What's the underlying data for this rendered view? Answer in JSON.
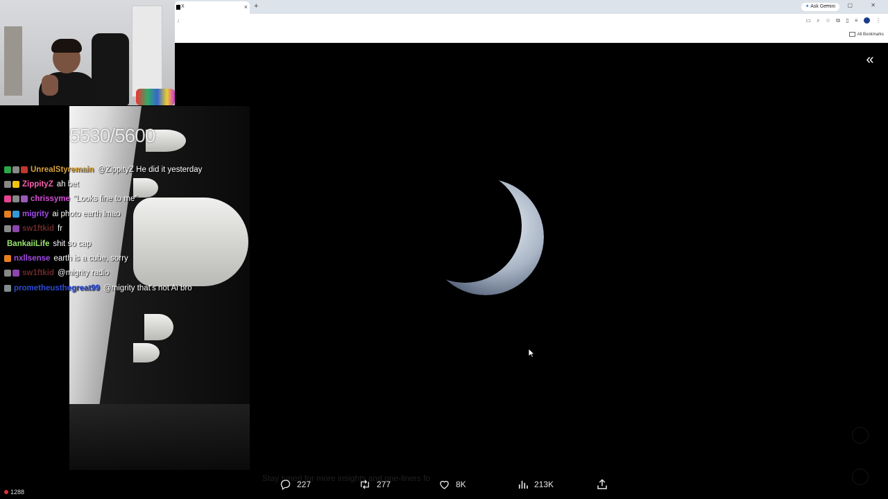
{
  "browser": {
    "tab_title": "X",
    "tab_close": "×",
    "new_tab": "+",
    "ask_gemini_label": "Ask Gemini",
    "address": "/",
    "all_bookmarks": "All Bookmarks",
    "window_controls": "– ▢ ✕"
  },
  "stream": {
    "counter": "5530/5600",
    "viewer_count": "1288",
    "chat": [
      {
        "user": "UnrealStyremain",
        "color": "#d7a33a",
        "text": "@ZippityZ He did it yesterday",
        "badges": [
          "#2aa84a",
          "#888888",
          "#c0392b"
        ]
      },
      {
        "user": "ZippityZ",
        "color": "#ff5fb0",
        "text": "ah bet",
        "badges": [
          "#888888",
          "#f1c40f"
        ]
      },
      {
        "user": "chrissyme",
        "color": "#d64fd6",
        "text": "\"Looks fine to me\"",
        "badges": [
          "#e84393",
          "#888888",
          "#9b59b6"
        ]
      },
      {
        "user": "migrity",
        "color": "#a24be6",
        "text": "ai photo earth lmao",
        "badges": [
          "#e67e22",
          "#3498db"
        ]
      },
      {
        "user": "sw1ftkid",
        "color": "#6b2a2a",
        "text": "fr",
        "badges": [
          "#888888",
          "#8e44ad"
        ]
      },
      {
        "user": "BankaiiLife",
        "color": "#9be86e",
        "text": "shit so cap",
        "badges": []
      },
      {
        "user": "nxllsense",
        "color": "#a24be6",
        "text": "earth is a cube, sorry",
        "badges": [
          "#e67e22"
        ]
      },
      {
        "user": "sw1ftkid",
        "color": "#6b2a2a",
        "text": "@migrity radio",
        "badges": [
          "#888888",
          "#8e44ad"
        ]
      },
      {
        "user": "prometheusthegreat99",
        "color": "#2b4bd6",
        "text": "@migrity that's not Ai bro",
        "badges": [
          "#7f8c8d"
        ]
      }
    ]
  },
  "post": {
    "collapse_icon": "«",
    "faint_caption": "Stay tuned for more insights and one-liners fo",
    "actions": {
      "replies": "227",
      "reposts": "277",
      "likes": "8K",
      "views": "213K"
    }
  }
}
